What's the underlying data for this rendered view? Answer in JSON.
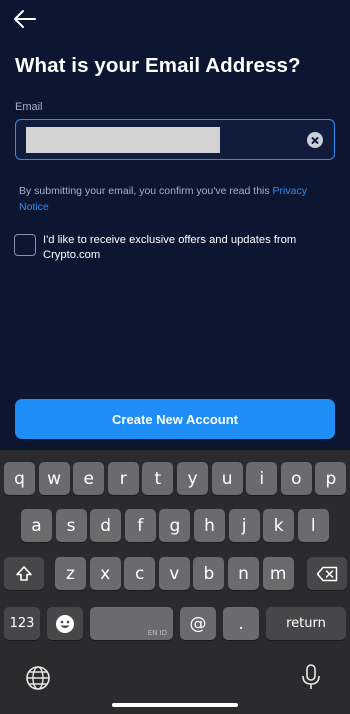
{
  "header": {
    "title": "What is your Email Address?"
  },
  "email": {
    "label": "Email",
    "value_redacted": true
  },
  "notice": {
    "text": "By submitting your email, you confirm you've read this ",
    "link": "Privacy Notice"
  },
  "offers": {
    "label": "I'd like to receive exclusive offers and updates from Crypto.com",
    "checked": false
  },
  "cta": {
    "label": "Create New Account",
    "color": "#1e8df5"
  },
  "keyboard": {
    "row1": [
      "q",
      "w",
      "e",
      "r",
      "t",
      "y",
      "u",
      "i",
      "o",
      "p"
    ],
    "row2": [
      "a",
      "s",
      "d",
      "f",
      "g",
      "h",
      "j",
      "k",
      "l"
    ],
    "row3": [
      "z",
      "x",
      "c",
      "v",
      "b",
      "n",
      "m"
    ],
    "numbers_key": "123",
    "space_lang": "EN ID",
    "at_key": "@",
    "dot_key": ".",
    "return_key": "return"
  }
}
